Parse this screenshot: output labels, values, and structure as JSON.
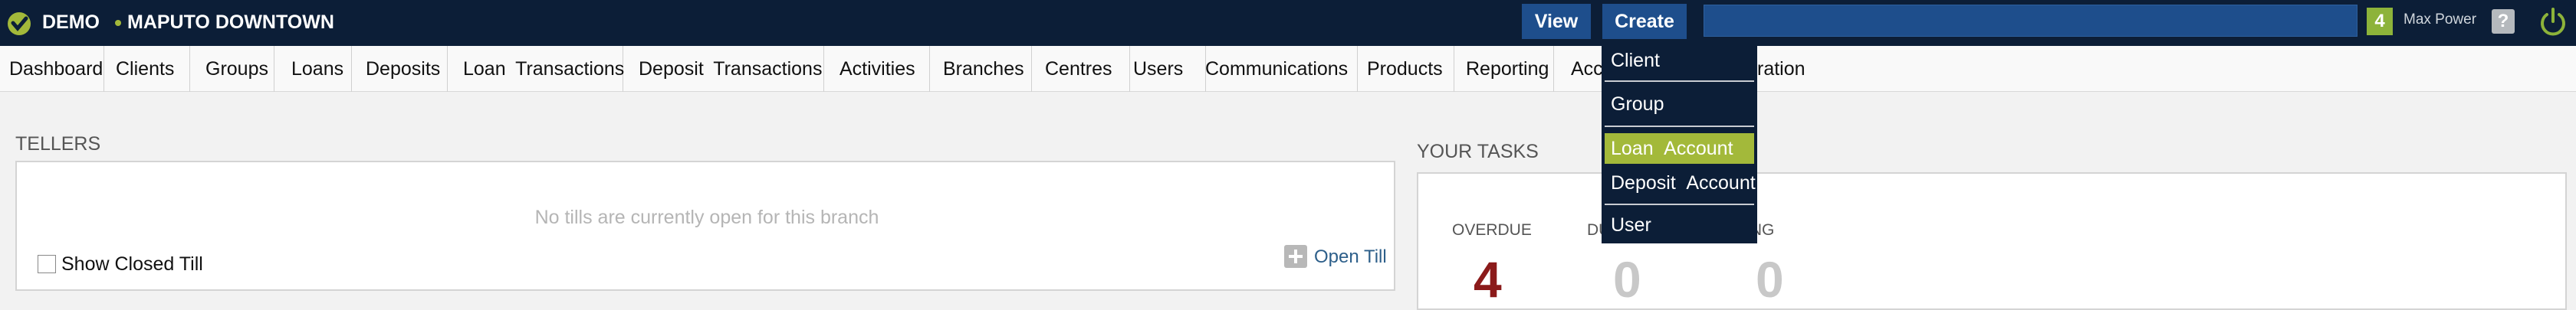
{
  "header": {
    "org_short": "DEMO",
    "office": "MAPUTO DOWNTOWN",
    "view_label": "View",
    "create_label": "Create",
    "search_value": "",
    "notifications": "4",
    "user": "Max Power",
    "help": "?"
  },
  "nav": {
    "items": [
      {
        "label": "Dashboard"
      },
      {
        "label": "Clients"
      },
      {
        "label": "Groups"
      },
      {
        "label": "Loans"
      },
      {
        "label": "Deposits"
      },
      {
        "label": "Loan Transactions"
      },
      {
        "label": "Deposit Transactions"
      },
      {
        "label": "Activities"
      },
      {
        "label": "Branches"
      },
      {
        "label": "Centres"
      },
      {
        "label": "Users"
      },
      {
        "label": "Communications"
      },
      {
        "label": "Products"
      },
      {
        "label": "Reporting"
      },
      {
        "label": "Acc"
      },
      {
        "label": "ration"
      }
    ]
  },
  "create_menu": {
    "items": [
      {
        "label": "Client"
      },
      {
        "label": "Group"
      },
      {
        "label": "Loan Account",
        "active": true
      },
      {
        "label": "Deposit Account"
      },
      {
        "label": "User"
      }
    ]
  },
  "tellers": {
    "title": "TELLERS",
    "empty_message": "No tills are currently open for this branch",
    "show_closed_label": "Show Closed Till",
    "show_closed_checked": false,
    "open_till_label": "Open Till"
  },
  "tasks": {
    "title": "YOUR TASKS",
    "overdue_label": "OVERDUE",
    "overdue_count": "4",
    "due_label": "DU",
    "due_count": "0",
    "upcoming_label": "COMING",
    "upcoming_count": "0"
  },
  "colors": {
    "topbar": "#0c1e37",
    "button": "#1e4e8c",
    "accent_green": "#a3b93a",
    "overdue": "#8b1a1a",
    "zero": "#c8c8c8"
  }
}
